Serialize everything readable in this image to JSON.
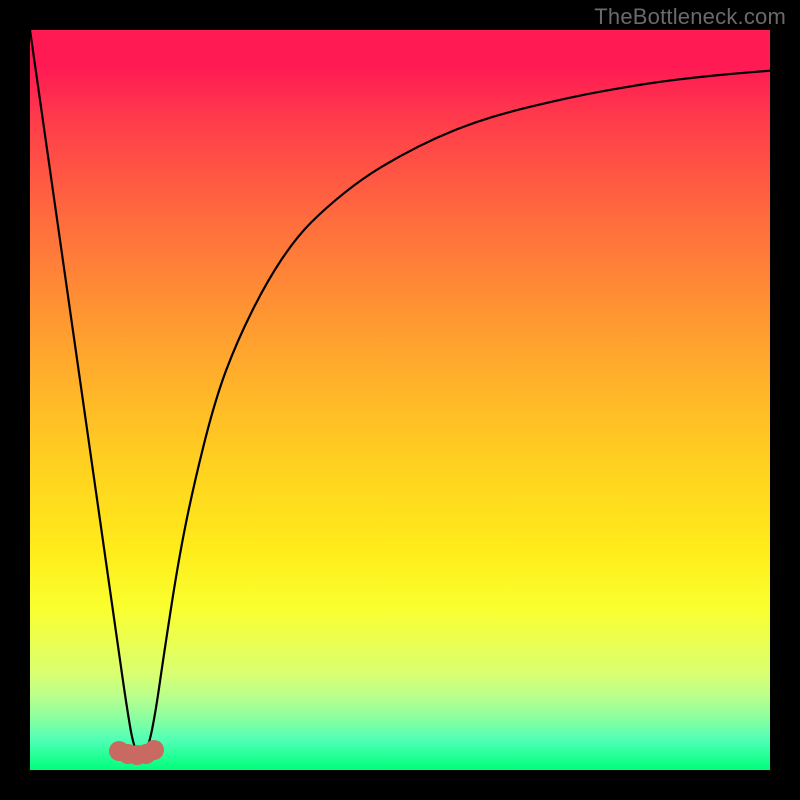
{
  "watermark": "TheBottleneck.com",
  "colors": {
    "curve_stroke": "#000000",
    "worm_fill": "#c86a61",
    "background": "#000000"
  },
  "chart_data": {
    "type": "line",
    "title": "",
    "xlabel": "",
    "ylabel": "",
    "xlim": [
      0,
      100
    ],
    "ylim": [
      0,
      100
    ],
    "grid": false,
    "legend": false,
    "annotations": [
      {
        "kind": "worm-marker",
        "x": 14,
        "y": 2
      }
    ],
    "series": [
      {
        "name": "bottleneck-curve",
        "x": [
          0,
          4,
          8,
          10,
          12,
          13,
          14,
          15,
          16,
          17,
          18,
          20,
          22,
          25,
          28,
          32,
          36,
          40,
          45,
          50,
          55,
          60,
          65,
          70,
          75,
          80,
          85,
          90,
          95,
          100
        ],
        "y": [
          100,
          72,
          44,
          30,
          16,
          9,
          3,
          2,
          3,
          8,
          15,
          28,
          38,
          50,
          58,
          66,
          72,
          76,
          80,
          83,
          85.5,
          87.5,
          89,
          90.2,
          91.3,
          92.2,
          93,
          93.6,
          94.1,
          94.5
        ]
      }
    ],
    "notes": "Axes are unitless (no tick labels shown on image). y values estimated from vertical position of curve against gradient; 0 = bottom (green), 100 = top (red). Minimum near x≈14."
  }
}
